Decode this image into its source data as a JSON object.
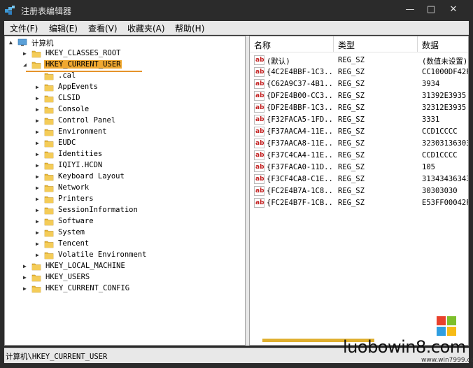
{
  "window": {
    "title": "注册表编辑器",
    "minimize": "—",
    "maximize": "□",
    "close": "✕"
  },
  "menu": [
    "文件(F)",
    "编辑(E)",
    "查看(V)",
    "收藏夹(A)",
    "帮助(H)"
  ],
  "tree": {
    "root": "计算机",
    "hives_before": [
      "HKEY_CLASSES_ROOT"
    ],
    "selected": "HKEY_CURRENT_USER",
    "children": [
      ".cal",
      "AppEvents",
      "CLSID",
      "Console",
      "Control Panel",
      "Environment",
      "EUDC",
      "Identities",
      "IQIYI.HCDN",
      "Keyboard Layout",
      "Network",
      "Printers",
      "SessionInformation",
      "Software",
      "System",
      "Tencent",
      "Volatile Environment"
    ],
    "hives_after": [
      "HKEY_LOCAL_MACHINE",
      "HKEY_USERS",
      "HKEY_CURRENT_CONFIG"
    ]
  },
  "columns": [
    "名称",
    "类型",
    "数据"
  ],
  "values": [
    {
      "name": "(默认)",
      "type": "REG_SZ",
      "data": "(数值未设置)"
    },
    {
      "name": "{4C2E4BBF-1C3...",
      "type": "REG_SZ",
      "data": "CC1000DF42F"
    },
    {
      "name": "{C62A9C37-4B1...",
      "type": "REG_SZ",
      "data": "3934"
    },
    {
      "name": "{DF2E4B00-CC3...",
      "type": "REG_SZ",
      "data": "31392E3935"
    },
    {
      "name": "{DF2E4BBF-1C3...",
      "type": "REG_SZ",
      "data": "32312E3935"
    },
    {
      "name": "{F32FACA5-1FD...",
      "type": "REG_SZ",
      "data": "3331"
    },
    {
      "name": "{F37AACA4-11E...",
      "type": "REG_SZ",
      "data": "CCD1CCCC"
    },
    {
      "name": "{F37AACA8-11E...",
      "type": "REG_SZ",
      "data": "32303136303"
    },
    {
      "name": "{F37C4CA4-11E...",
      "type": "REG_SZ",
      "data": "CCD1CCCC"
    },
    {
      "name": "{F37FACA0-11D...",
      "type": "REG_SZ",
      "data": "105"
    },
    {
      "name": "{F3CF4CA8-C1E...",
      "type": "REG_SZ",
      "data": "31343436343"
    },
    {
      "name": "{FC2E4B7A-1C8...",
      "type": "REG_SZ",
      "data": "30303030"
    },
    {
      "name": "{FC2E4B7F-1CB...",
      "type": "REG_SZ",
      "data": "E53FF00042F"
    }
  ],
  "string_icon_text": "ab",
  "status": "计算机\\HKEY_CURRENT_USER",
  "watermark": {
    "main": "luobowin8.com",
    "sub": "www.win7999.com"
  },
  "colors": {
    "selection": "#f0a830",
    "string_icon": "#c42323",
    "folder": "#e8b83a"
  }
}
